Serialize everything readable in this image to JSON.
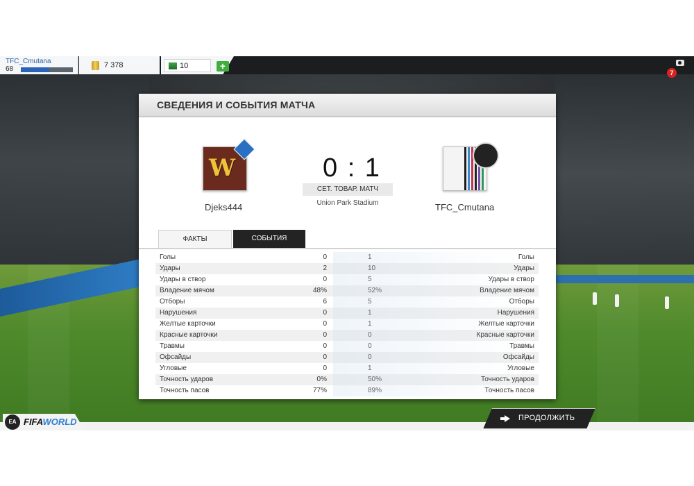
{
  "hud": {
    "player_name": "TFC_Cmutana",
    "player_level": "68",
    "xp_progress": 0.55,
    "coins": "7 378",
    "points": "10",
    "add_label": "+",
    "notification_count": "7"
  },
  "panel": {
    "title": "СВЕДЕНИЯ И СОБЫТИЯ МАТЧА",
    "home_team": "Djeks444",
    "away_team": "TFC_Cmutana",
    "score": "0 : 1",
    "match_type": "СЕТ. ТОВАР. МАТЧ",
    "stadium": "Union Park Stadium",
    "home_badge_letter": "W",
    "tabs": [
      "ФАКТЫ",
      "СОБЫТИЯ"
    ]
  },
  "stats": [
    {
      "label": "Голы",
      "home": "0",
      "away": "1"
    },
    {
      "label": "Удары",
      "home": "2",
      "away": "10"
    },
    {
      "label": "Удары в створ",
      "home": "0",
      "away": "5"
    },
    {
      "label": "Владение мячом",
      "home": "48%",
      "away": "52%"
    },
    {
      "label": "Отборы",
      "home": "6",
      "away": "5"
    },
    {
      "label": "Нарушения",
      "home": "0",
      "away": "1"
    },
    {
      "label": "Желтые карточки",
      "home": "0",
      "away": "1"
    },
    {
      "label": "Красные карточки",
      "home": "0",
      "away": "0"
    },
    {
      "label": "Травмы",
      "home": "0",
      "away": "0"
    },
    {
      "label": "Офсайды",
      "home": "0",
      "away": "0"
    },
    {
      "label": "Угловые",
      "home": "0",
      "away": "1"
    },
    {
      "label": "Точность ударов",
      "home": "0%",
      "away": "50%"
    },
    {
      "label": "Точность пасов",
      "home": "77%",
      "away": "89%"
    }
  ],
  "footer": {
    "ea_label": "EA",
    "logo_fifa": "FIFA",
    "logo_world": "WORLD",
    "continue_label": "ПРОДОЛЖИТЬ"
  }
}
